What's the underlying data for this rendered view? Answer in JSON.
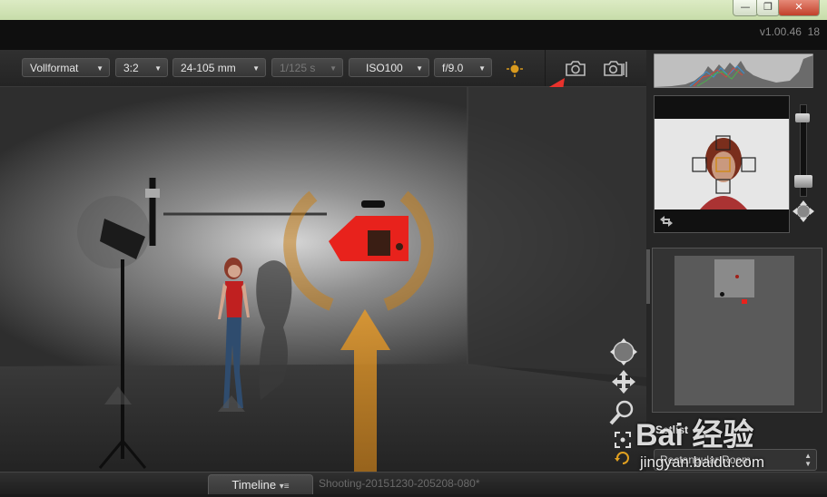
{
  "app": {
    "version": "v1.00.46",
    "version_extra": "18"
  },
  "window_controls": {
    "minimize": "—",
    "restore": "❐",
    "close": "✕"
  },
  "toolbar": {
    "sensor": "Vollformat",
    "aspect": "3:2",
    "lens": "24-105 mm",
    "shutter": "1/125 s",
    "iso": "ISO100",
    "aperture": "f/9.0"
  },
  "sidebar": {
    "setlist_label": "Setlist",
    "setlist_value": "Rectangular Room"
  },
  "bottom": {
    "timeline_label": "Timeline",
    "timeline_caret": "▾≡",
    "shooting_name": "Shooting-20151230-205208-080*"
  },
  "watermark": {
    "text": "Bai 经验",
    "url": "jingyan.baidu.com"
  },
  "colors": {
    "accent_red": "#e8221c",
    "accent_orange": "#d98a1e",
    "annotation_arrow": "#e8322c"
  }
}
